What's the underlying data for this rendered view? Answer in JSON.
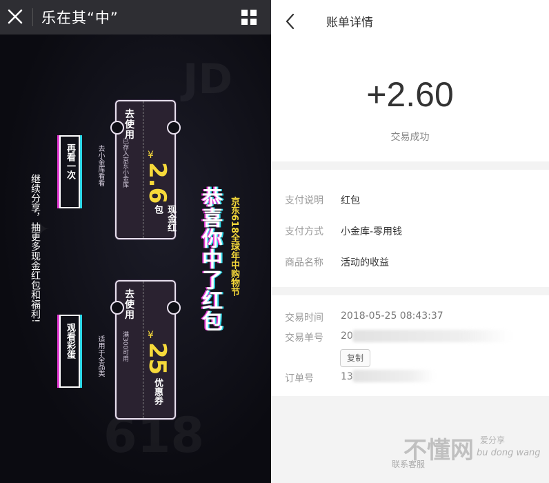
{
  "left": {
    "title": "乐在其“中”",
    "ticket1": {
      "use": "去使用",
      "currency": "¥",
      "amount": "2.6",
      "type": "现金红包",
      "desc1": "已存入京东小金库",
      "desc2": "去小金库看看"
    },
    "ticket2": {
      "use": "去使用",
      "currency": "¥",
      "amount": "25",
      "type": "优惠券",
      "desc1": "满300可用",
      "desc2": "适用于全品类"
    },
    "headline": "恭喜你中了红包",
    "subheadline": "京东618全球年中购物节",
    "replay_button": "再看一次",
    "easter_button": "观看彩蛋",
    "share_text": "继续分享，抽更多现金红包和福利!"
  },
  "right": {
    "title": "账单详情",
    "amount": "+2.60",
    "status": "交易成功",
    "info": [
      {
        "label": "支付说明",
        "value": "红包"
      },
      {
        "label": "支付方式",
        "value": "小金库-零用钱"
      },
      {
        "label": "商品名称",
        "value": "活动的收益"
      }
    ],
    "trade_time_label": "交易时间",
    "trade_time": "2018-05-25 08:43:37",
    "trade_no_label": "交易单号",
    "trade_no_prefix": "20",
    "copy_label": "复制",
    "order_no_label": "订单号",
    "order_no_prefix": "13",
    "contact": "联系客服",
    "watermark_cn": "不懂网",
    "watermark_sub": "爱分享",
    "watermark_pinyin": "bu dong wang"
  }
}
